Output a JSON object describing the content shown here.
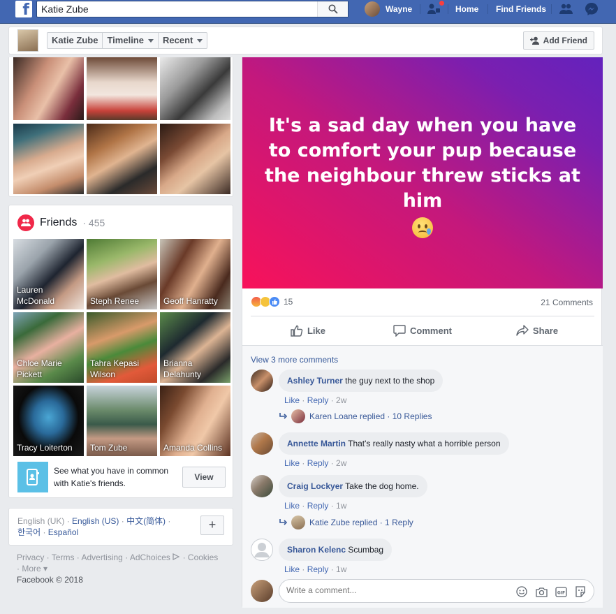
{
  "topbar": {
    "search_value": "Katie Zube",
    "user_name": "Wayne",
    "home": "Home",
    "find_friends": "Find Friends"
  },
  "header": {
    "crumbs": [
      "Katie Zube",
      "Timeline",
      "Recent"
    ],
    "add_friend": "Add Friend"
  },
  "friends": {
    "title": "Friends",
    "count": "· 455",
    "list": [
      {
        "name": "Lauren McDonald",
        "line1": "Lauren",
        "line2": "McDonald"
      },
      {
        "name": "Steph Renee",
        "line1": "Steph Renee",
        "line2": ""
      },
      {
        "name": "Geoff Hanratty",
        "line1": "Geoff Hanratty",
        "line2": ""
      },
      {
        "name": "Chloe Marie Pickett",
        "line1": "Chloe Marie",
        "line2": "Pickett"
      },
      {
        "name": "Tahra Kepasi Wilson",
        "line1": "Tahra Kepasi",
        "line2": "Wilson"
      },
      {
        "name": "Brianna Delahunty",
        "line1": "Brianna",
        "line2": "Delahunty"
      },
      {
        "name": "Tracy Loiterton",
        "line1": "Tracy Loiterton",
        "line2": ""
      },
      {
        "name": "Tom Zube",
        "line1": "Tom Zube",
        "line2": ""
      },
      {
        "name": "Amanda Collins",
        "line1": "Amanda Collins",
        "line2": ""
      }
    ],
    "suggest_text": "See what you have in common with Katie's friends.",
    "view_button": "View"
  },
  "languages": {
    "current": "English (UK) ·",
    "links": [
      "English (US)",
      "中文(简体)",
      "한국어",
      "Español"
    ]
  },
  "footer": {
    "links": [
      "Privacy",
      "Terms",
      "Advertising",
      "AdChoices",
      "Cookies",
      "More"
    ],
    "copyright": "Facebook © 2018"
  },
  "post": {
    "text": "It's a sad day when you have to comfort your pup because the neighbour threw sticks at him",
    "reaction_count": "15",
    "comments_count": "21 Comments",
    "actions": [
      "Like",
      "Comment",
      "Share"
    ],
    "view_more": "View 3 more comments",
    "comments": [
      {
        "name": "Ashley Turner",
        "text": "the guy next to the shop",
        "meta_like": "Like",
        "meta_reply": "Reply",
        "time": "2w"
      },
      {
        "name": "Annette Martin",
        "text": "That's really nasty what a horrible person",
        "meta_like": "Like",
        "meta_reply": "Reply",
        "time": "2w"
      },
      {
        "name": "Craig Lockyer",
        "text": "Take the dog home.",
        "meta_like": "Like",
        "meta_reply": "Reply",
        "time": "1w"
      },
      {
        "name": "Sharon Kelenc",
        "text": "Scumbag",
        "meta_like": "Like",
        "meta_reply": "Reply",
        "time": "1w"
      }
    ],
    "replies": [
      {
        "text": "Karen Loane replied · 10 Replies"
      },
      {
        "text": "Katie Zube replied · 1 Reply"
      }
    ],
    "write_placeholder": "Write a comment..."
  },
  "colors": {
    "brand_blue": "#4267b2",
    "link_blue": "#365899",
    "banner_start": "#f8125a",
    "banner_end": "#6322bd"
  }
}
